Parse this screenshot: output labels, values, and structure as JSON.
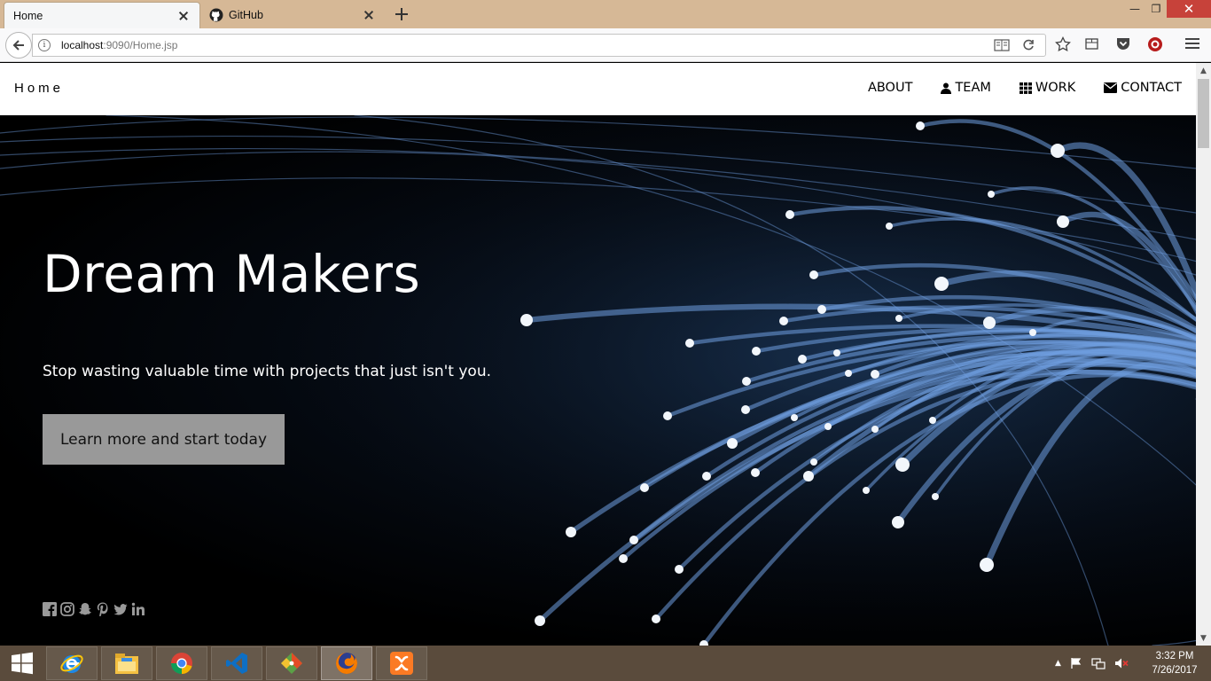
{
  "browser": {
    "tabs": [
      {
        "title": "Home",
        "active": true
      },
      {
        "title": "GitHub",
        "active": false
      }
    ],
    "url_host": "localhost",
    "url_rest": ":9090/Home.jsp"
  },
  "site": {
    "brand": "Home",
    "nav": [
      {
        "label": "ABOUT",
        "icon": "none"
      },
      {
        "label": "TEAM",
        "icon": "user-icon"
      },
      {
        "label": "WORK",
        "icon": "grid-icon"
      },
      {
        "label": "CONTACT",
        "icon": "envelope-icon"
      }
    ]
  },
  "hero": {
    "title": "Dream Makers",
    "subtitle": "Stop wasting valuable time with projects that just isn't you.",
    "cta": "Learn more and start today",
    "social": [
      "facebook-icon",
      "instagram-icon",
      "snapchat-icon",
      "pinterest-icon",
      "twitter-icon",
      "linkedin-icon"
    ]
  },
  "taskbar": {
    "apps": [
      "internet-explorer-icon",
      "file-explorer-icon",
      "chrome-icon",
      "visual-studio-icon",
      "git-icon",
      "firefox-icon",
      "xampp-icon"
    ],
    "time": "3:32 PM",
    "date": "7/26/2017"
  },
  "colors": {
    "tab_strip": "#d6b896",
    "cta_background": "#999999",
    "taskbar": "#5a4b3c",
    "fiber_blue": "#6f9ee0"
  }
}
